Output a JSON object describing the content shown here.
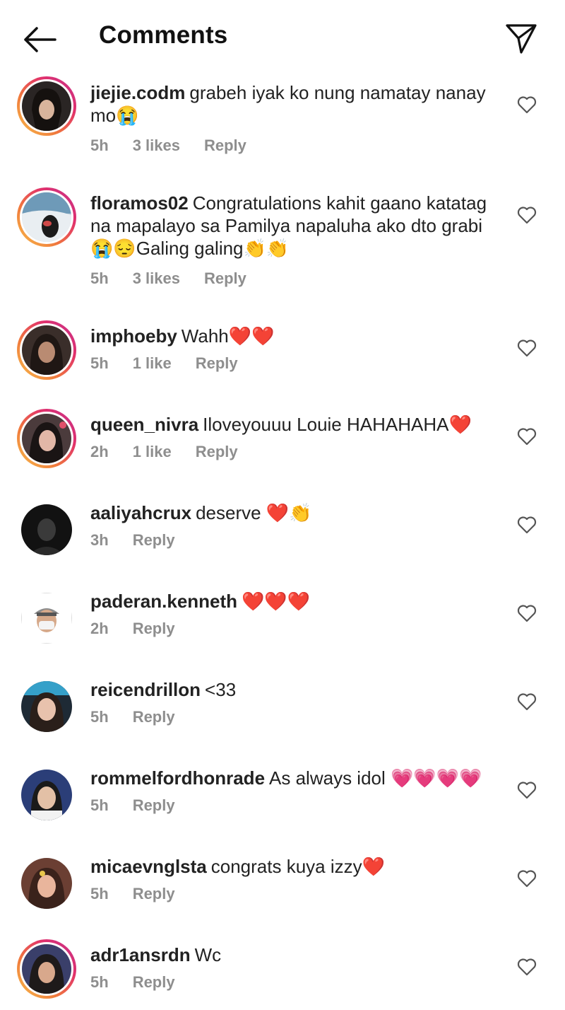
{
  "header": {
    "title": "Comments"
  },
  "comments": [
    {
      "user": "jiejie.codm",
      "text": "grabeh iyak ko nung namatay nanay mo😭",
      "time": "5h",
      "likes": "3 likes",
      "reply": "Reply"
    },
    {
      "user": "floramos02",
      "text": "Congratulations kahit gaano katatag na mapalayo sa Pamilya napaluha ako dto grabi😭😔Galing galing👏👏",
      "time": "5h",
      "likes": "3 likes",
      "reply": "Reply"
    },
    {
      "user": "imphoeby",
      "text": "Wahh❤️❤️",
      "time": "5h",
      "likes": "1 like",
      "reply": "Reply"
    },
    {
      "user": "queen_nivra",
      "text": "Iloveyouuu Louie HAHAHAHA❤️",
      "time": "2h",
      "likes": "1 like",
      "reply": "Reply"
    },
    {
      "user": "aaliyahcrux",
      "text": "deserve ❤️👏",
      "time": "3h",
      "reply": "Reply"
    },
    {
      "user": "paderan.kenneth",
      "text": "❤️❤️❤️",
      "time": "2h",
      "reply": "Reply"
    },
    {
      "user": "reicendrillon",
      "text": "<33",
      "time": "5h",
      "reply": "Reply"
    },
    {
      "user": "rommelfordhonrade",
      "text": "As always idol 💗💗💗💗",
      "time": "5h",
      "reply": "Reply"
    },
    {
      "user": "micaevnglsta",
      "text": "congrats kuya izzy❤️",
      "time": "5h",
      "reply": "Reply"
    },
    {
      "user": "adr1ansrdn",
      "text": "Wc",
      "time": "5h",
      "reply": "Reply"
    }
  ],
  "icons": {
    "back": "back-arrow-icon",
    "send": "send-direct-icon",
    "like": "heart-outline-icon"
  },
  "colors": {
    "meta": "#8e8e8e",
    "story_ring_start": "#f8c14c",
    "story_ring_end": "#c2338f"
  }
}
